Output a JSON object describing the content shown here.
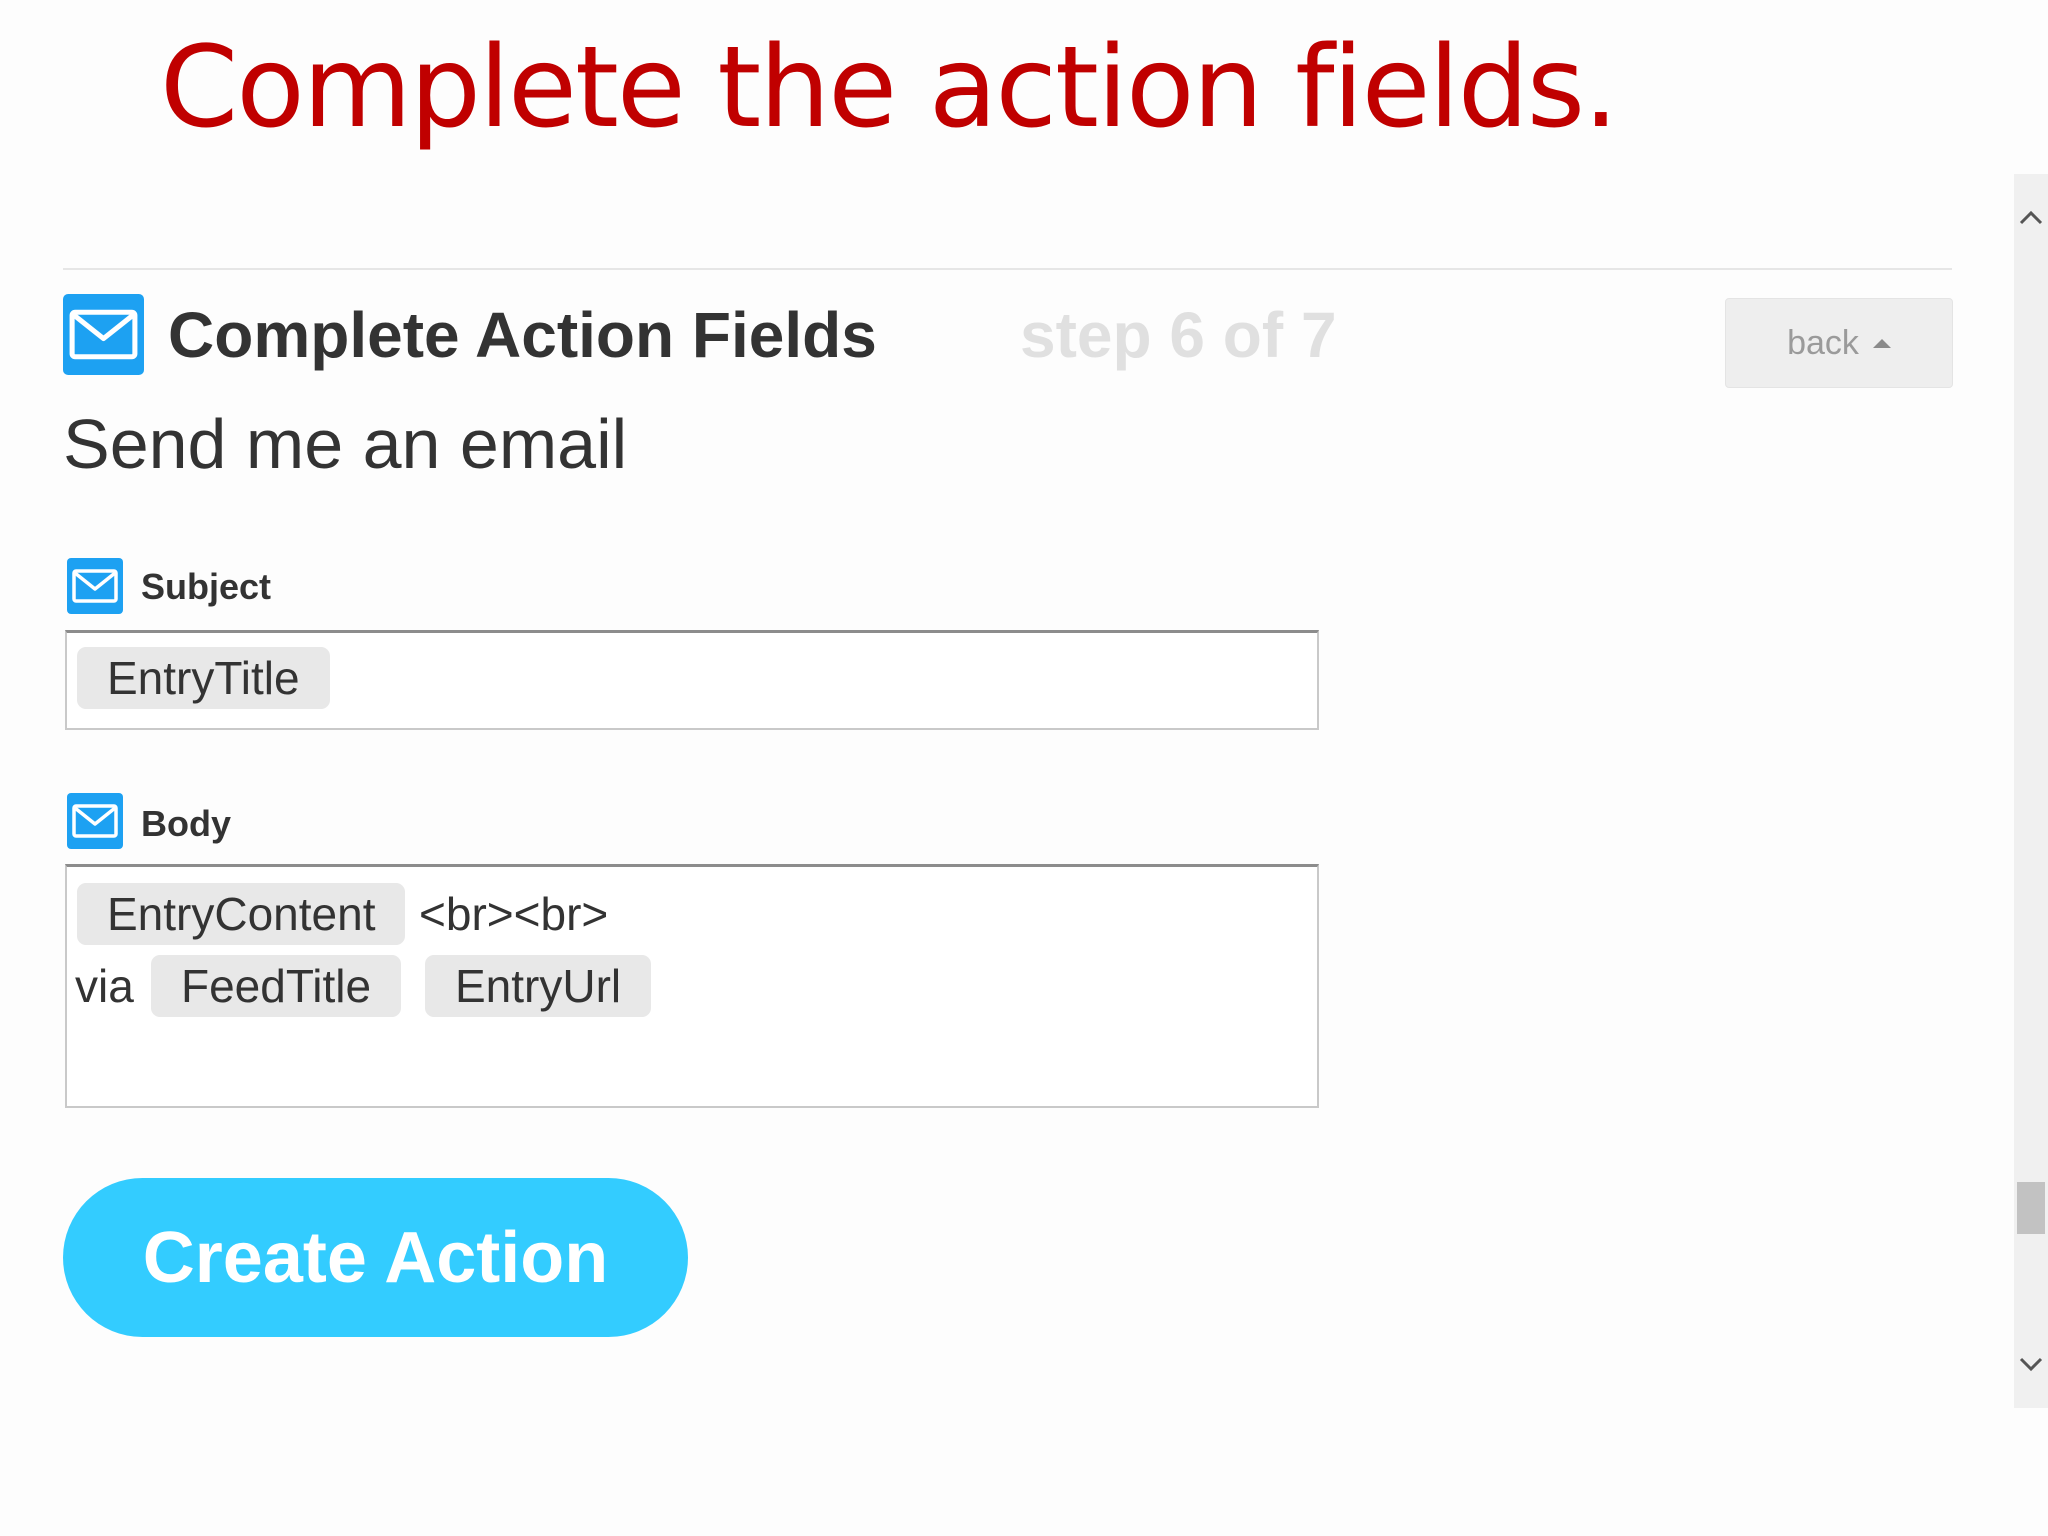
{
  "slide": {
    "title": "Complete the action fields."
  },
  "header": {
    "icon": "envelope-icon",
    "title": "Complete Action Fields",
    "step": "step 6 of 7",
    "back_label": "back"
  },
  "action": {
    "name": "Send me an email"
  },
  "fields": {
    "subject": {
      "label": "Subject",
      "icon": "envelope-icon",
      "tokens": [
        "EntryTitle"
      ]
    },
    "body": {
      "label": "Body",
      "icon": "envelope-icon",
      "token_entry_content": "EntryContent",
      "text_breaks": "<br><br>",
      "text_via": "via",
      "token_feed_title": "FeedTitle",
      "token_entry_url": "EntryUrl"
    }
  },
  "buttons": {
    "create_action": "Create Action"
  },
  "colors": {
    "title_red": "#c00000",
    "accent_blue": "#33ccff",
    "icon_blue": "#1da1f2"
  }
}
